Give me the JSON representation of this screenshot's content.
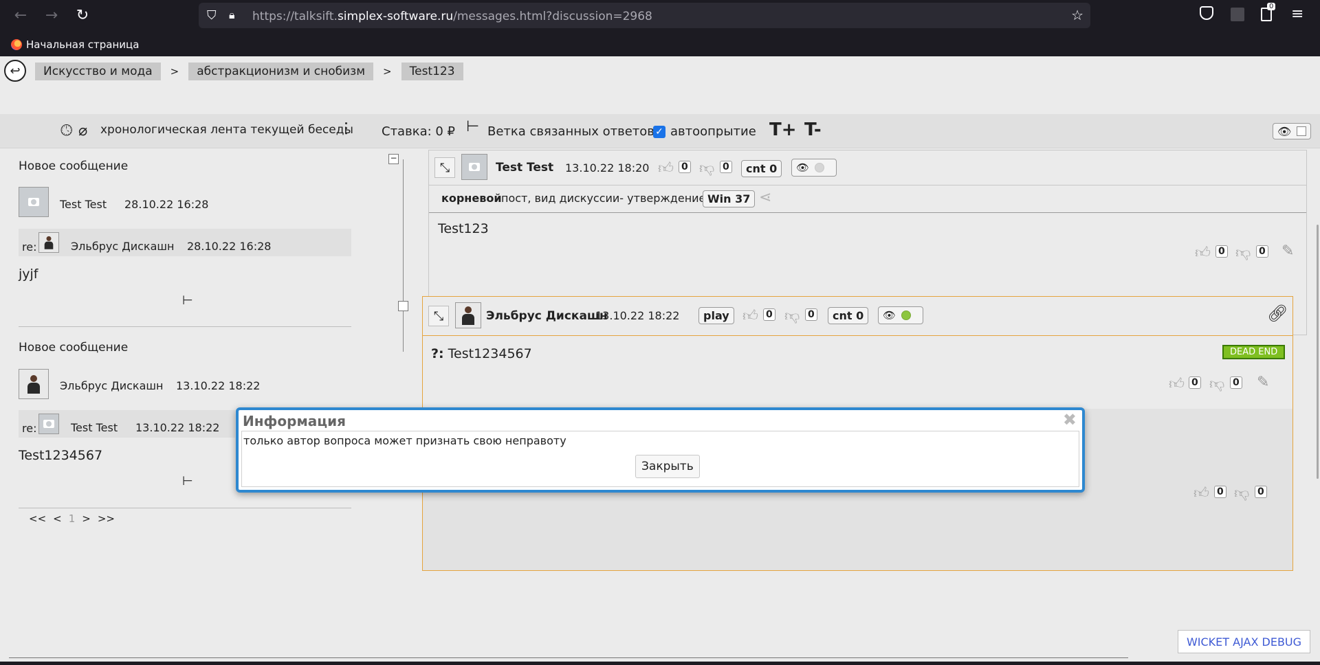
{
  "browser": {
    "url_prefix": "https://talksift.",
    "url_host": "simplex-software.ru",
    "url_path": "/messages.html?discussion=2968",
    "bookmark": "Начальная страница",
    "badge_count": "0"
  },
  "breadcrumbs": [
    "Искусство и мода",
    "абстракционизм и снобизм",
    "Test123"
  ],
  "breadcrumb_sep": ">",
  "toolbar": {
    "timeline_label": "хронологическая лента текущей беседы",
    "stake_label": "Ставка: 0 ₽",
    "branch_label": "Ветка связанных ответов",
    "autoopen_label": "автоопрытие",
    "t_plus": "T+",
    "t_minus": "T-"
  },
  "feed": [
    {
      "title": "Новое сообщение",
      "author": "Test Test",
      "time": "28.10.22 16:28",
      "re_label": "re:",
      "re_author": "Эльбрус Дискашн",
      "re_time": "28.10.22 16:28",
      "body": "jyjf"
    },
    {
      "title": "Новое сообщение",
      "author": "Эльбрус Дискашн",
      "time": "13.10.22 18:22",
      "re_label": "re:",
      "re_author": "Test Test",
      "re_time": "13.10.22 18:22",
      "body": "Test1234567"
    }
  ],
  "pager": {
    "first": "<<",
    "prev": "<",
    "current": "1",
    "next": ">",
    "last": ">>"
  },
  "root_post": {
    "author": "Test Test",
    "time": "13.10.22 18:20",
    "likes": "0",
    "dislikes": "0",
    "cnt": "cnt 0",
    "type_bold": "корневой",
    "type_rest": "пост, вид дискуссии- утверждение",
    "win": "Win 37",
    "body": "Test123",
    "foot_likes": "0",
    "foot_dislikes": "0"
  },
  "reply_post": {
    "author": "Эльбрус Дискашн",
    "time": "13.10.22 18:22",
    "play": "play",
    "likes": "0",
    "dislikes": "0",
    "cnt": "cnt 0",
    "body_prefix": "?:",
    "body": "Test1234567",
    "dead_end": "DEAD END",
    "foot_likes": "0",
    "foot_dislikes": "0",
    "foot2_likes": "0",
    "foot2_dislikes": "0"
  },
  "modal": {
    "title": "Информация",
    "message": "только автор вопроса может признать свою неправоту",
    "close_button": "Закрыть"
  },
  "debug_button": "WICKET AJAX DEBUG"
}
